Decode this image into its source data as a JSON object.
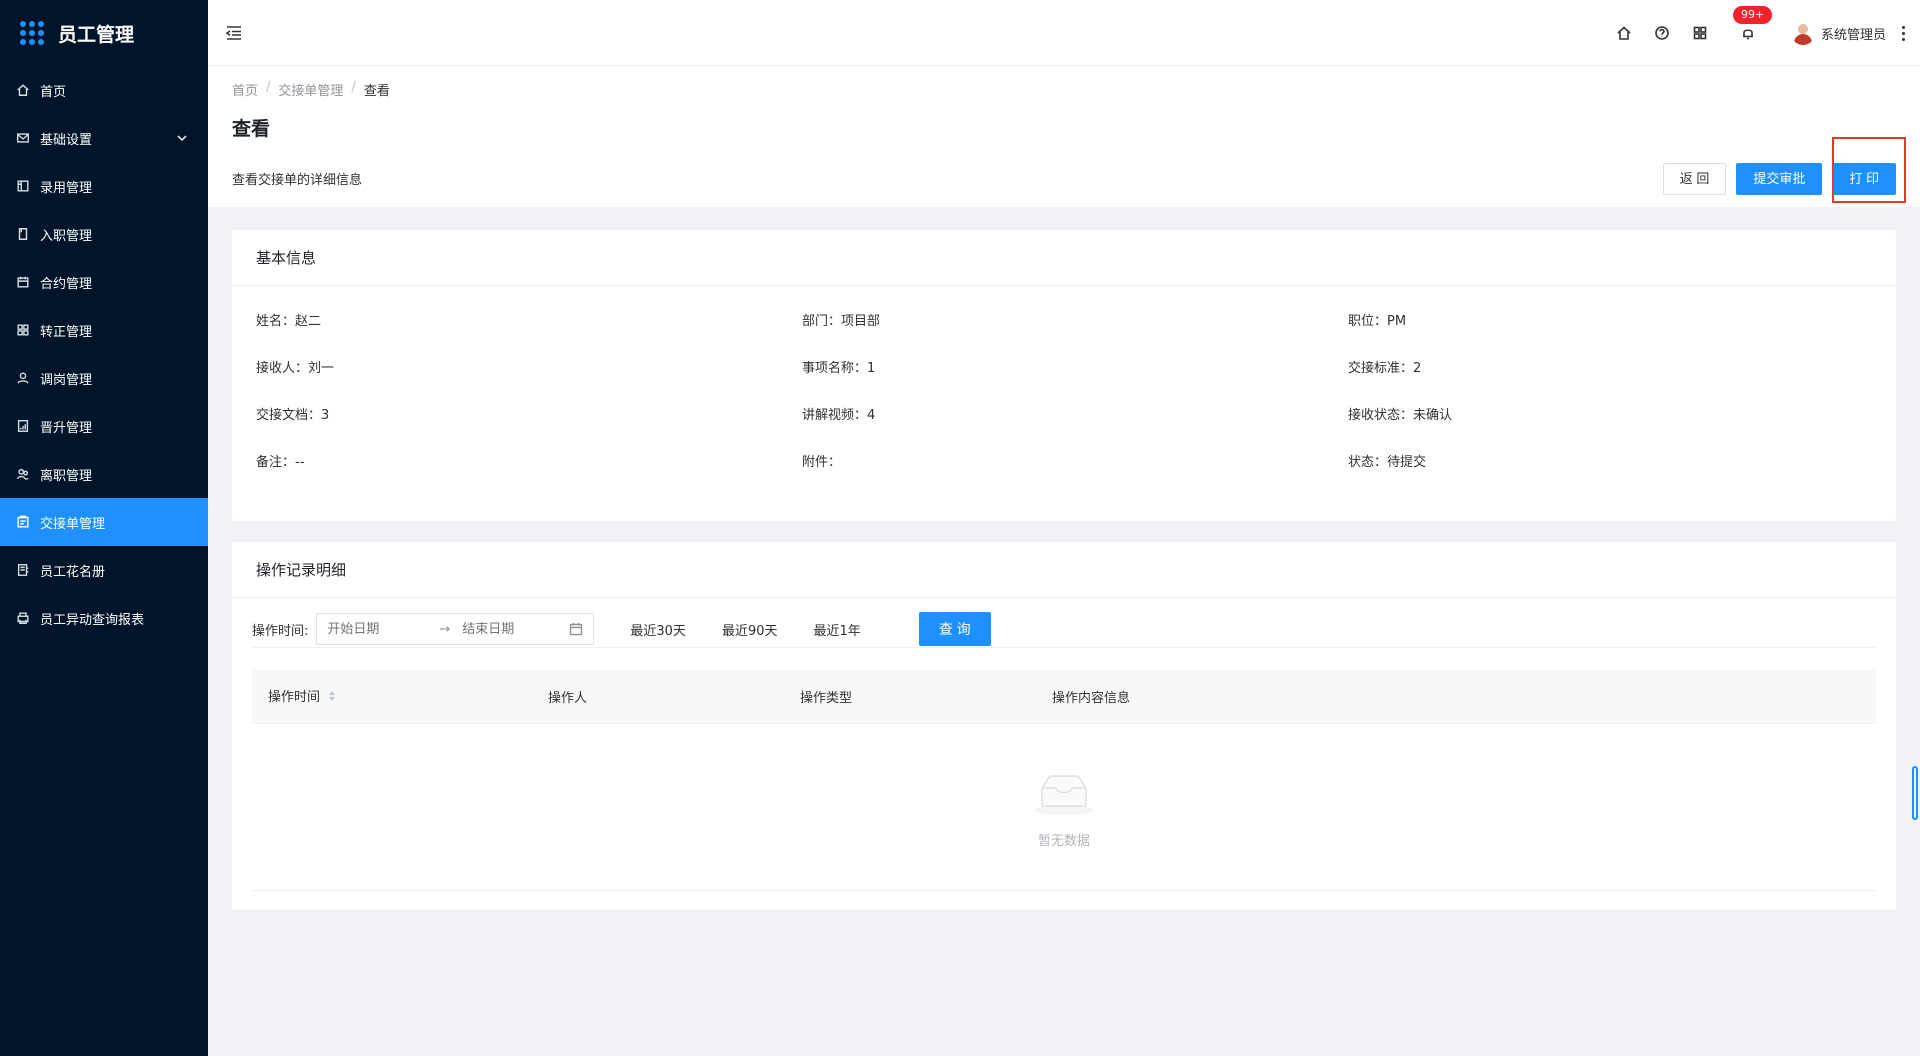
{
  "brand": {
    "title": "员工管理"
  },
  "sidebar": {
    "items": [
      {
        "label": "首页",
        "icon": "home-icon"
      },
      {
        "label": "基础设置",
        "icon": "mail-icon",
        "expandable": true
      },
      {
        "label": "录用管理",
        "icon": "board-icon"
      },
      {
        "label": "入职管理",
        "icon": "file-icon"
      },
      {
        "label": "合约管理",
        "icon": "calendar-icon"
      },
      {
        "label": "转正管理",
        "icon": "grid-icon"
      },
      {
        "label": "调岗管理",
        "icon": "user-icon"
      },
      {
        "label": "晋升管理",
        "icon": "report-icon"
      },
      {
        "label": "离职管理",
        "icon": "team-icon"
      },
      {
        "label": "交接单管理",
        "icon": "form-icon",
        "active": true
      },
      {
        "label": "员工花名册",
        "icon": "roster-icon"
      },
      {
        "label": "员工异动查询报表",
        "icon": "print-icon"
      }
    ]
  },
  "header": {
    "notification_badge": "99+",
    "user_name": "系统管理员"
  },
  "breadcrumb": [
    "首页",
    "交接单管理",
    "查看"
  ],
  "page": {
    "title": "查看",
    "description": "查看交接单的详细信息",
    "buttons": {
      "back": "返 回",
      "submit": "提交审批",
      "print": "打 印"
    }
  },
  "basic_info": {
    "title": "基本信息",
    "fields": [
      {
        "label": "姓名：",
        "value": "赵二"
      },
      {
        "label": "部门：",
        "value": "项目部"
      },
      {
        "label": "职位：",
        "value": "PM"
      },
      {
        "label": "接收人：",
        "value": "刘一"
      },
      {
        "label": "事项名称：",
        "value": "1"
      },
      {
        "label": "交接标准：",
        "value": "2"
      },
      {
        "label": "交接文档：",
        "value": "3"
      },
      {
        "label": "讲解视频：",
        "value": "4"
      },
      {
        "label": "接收状态：",
        "value": "未确认"
      },
      {
        "label": "备注：",
        "value": "--"
      },
      {
        "label": "附件：",
        "value": ""
      },
      {
        "label": "状态：",
        "value": "待提交"
      }
    ]
  },
  "records": {
    "title": "操作记录明细",
    "filter": {
      "label": "操作时间:",
      "start_placeholder": "开始日期",
      "end_placeholder": "结束日期",
      "quick_ranges": [
        "最近30天",
        "最近90天",
        "最近1年"
      ],
      "query_button": "查 询"
    },
    "columns": [
      "操作时间",
      "操作人",
      "操作类型",
      "操作内容信息"
    ],
    "empty_text": "暂无数据"
  },
  "colors": {
    "sidebar_bg": "#001529",
    "primary": "#1e90ff",
    "highlight": "#e8382e"
  }
}
